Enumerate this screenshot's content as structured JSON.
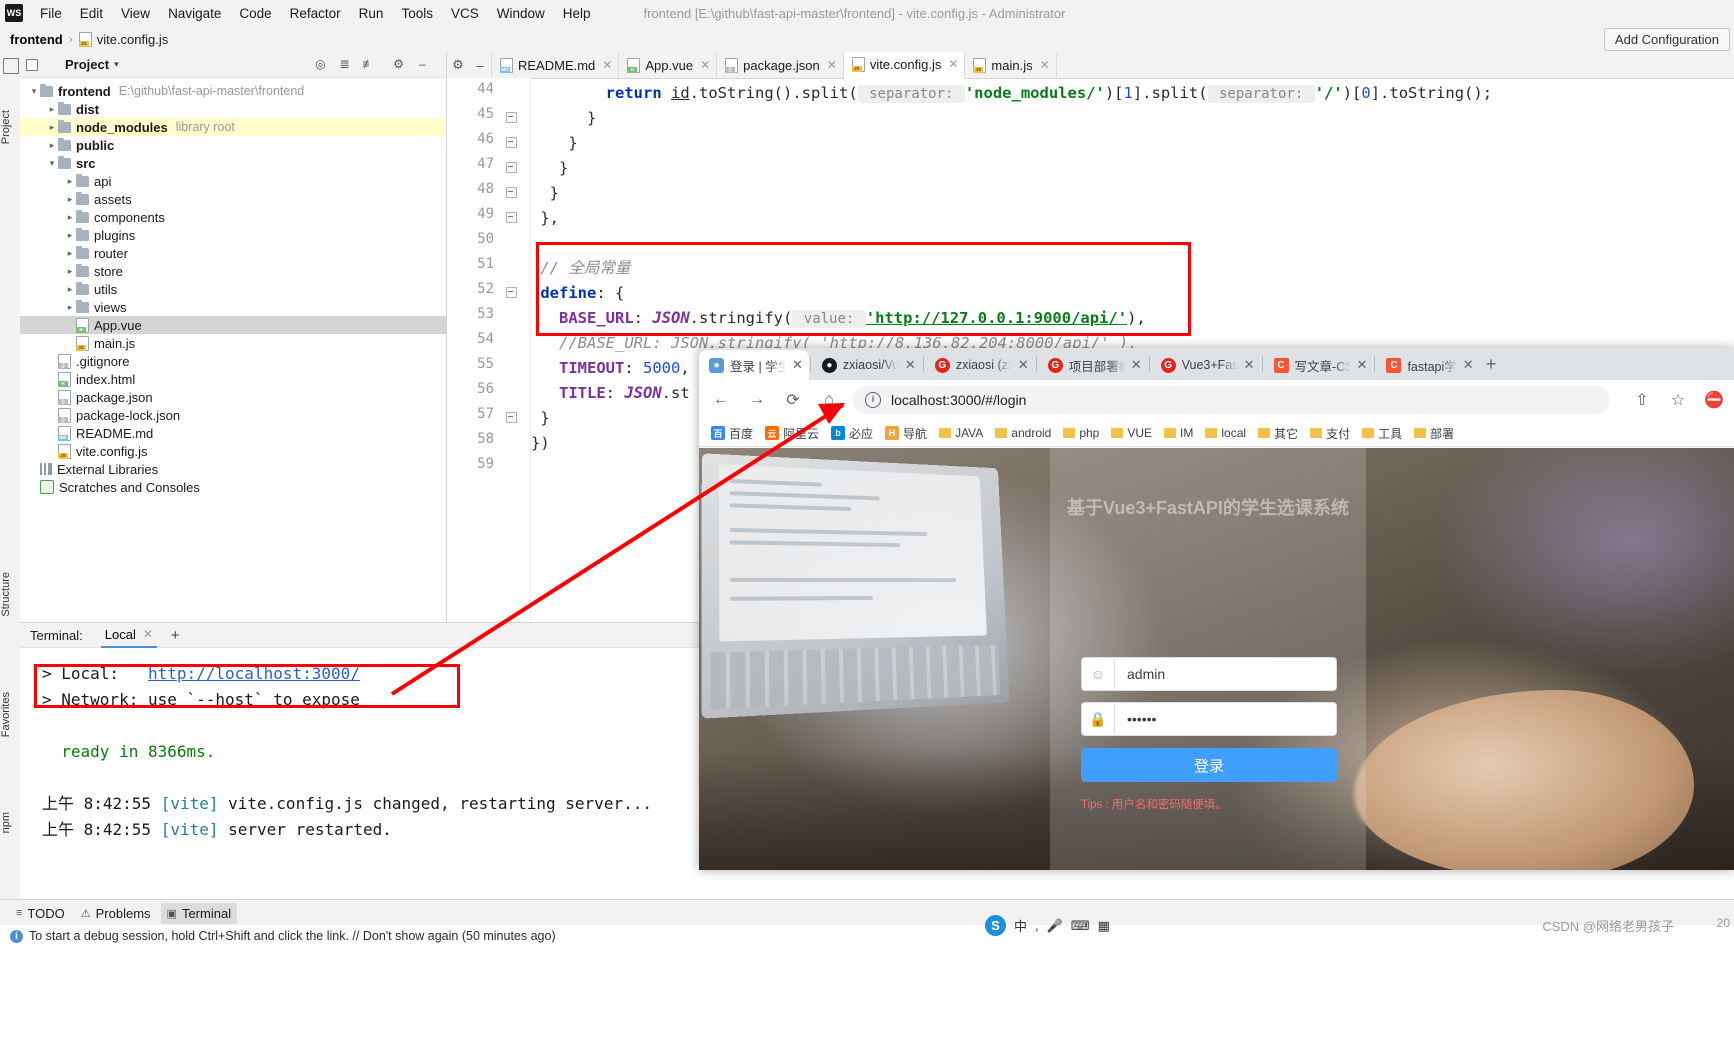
{
  "titlebar": {
    "logo": "WS",
    "menus": [
      "File",
      "Edit",
      "View",
      "Navigate",
      "Code",
      "Refactor",
      "Run",
      "Tools",
      "VCS",
      "Window",
      "Help"
    ],
    "title": "frontend [E:\\github\\fast-api-master\\frontend] - vite.config.js - Administrator"
  },
  "navbar": {
    "crumb_root": "frontend",
    "crumb_sep": "›",
    "crumb_file": "vite.config.js",
    "add_configuration": "Add Configuration"
  },
  "left_strip": {
    "project": "Project",
    "structure": "Structure",
    "favorites": "Favorites",
    "npm": "npm"
  },
  "project_panel": {
    "header": "Project",
    "header_caret": "▾",
    "tree": [
      {
        "depth": 0,
        "arrow": "open",
        "icon": "folder",
        "label": "frontend",
        "bold": true,
        "hint": "E:\\github\\fast-api-master\\frontend"
      },
      {
        "depth": 1,
        "arrow": "closed",
        "icon": "folder",
        "label": "dist",
        "bold": true,
        "hint": ""
      },
      {
        "depth": 1,
        "arrow": "closed",
        "icon": "folder",
        "label": "node_modules",
        "bold": true,
        "hint": "library root",
        "row": "lib"
      },
      {
        "depth": 1,
        "arrow": "closed",
        "icon": "folder",
        "label": "public",
        "bold": true,
        "hint": ""
      },
      {
        "depth": 1,
        "arrow": "open",
        "icon": "folder",
        "label": "src",
        "bold": true,
        "hint": ""
      },
      {
        "depth": 2,
        "arrow": "closed",
        "icon": "folder",
        "label": "api",
        "bold": false,
        "hint": ""
      },
      {
        "depth": 2,
        "arrow": "closed",
        "icon": "folder",
        "label": "assets",
        "bold": false,
        "hint": ""
      },
      {
        "depth": 2,
        "arrow": "closed",
        "icon": "folder",
        "label": "components",
        "bold": false,
        "hint": ""
      },
      {
        "depth": 2,
        "arrow": "closed",
        "icon": "folder",
        "label": "plugins",
        "bold": false,
        "hint": ""
      },
      {
        "depth": 2,
        "arrow": "closed",
        "icon": "folder",
        "label": "router",
        "bold": false,
        "hint": ""
      },
      {
        "depth": 2,
        "arrow": "closed",
        "icon": "folder",
        "label": "store",
        "bold": false,
        "hint": ""
      },
      {
        "depth": 2,
        "arrow": "closed",
        "icon": "folder",
        "label": "utils",
        "bold": false,
        "hint": ""
      },
      {
        "depth": 2,
        "arrow": "closed",
        "icon": "folder",
        "label": "views",
        "bold": false,
        "hint": ""
      },
      {
        "depth": 2,
        "arrow": "none",
        "icon": "file-h",
        "label": "App.vue",
        "bold": false,
        "hint": "",
        "row": "sel"
      },
      {
        "depth": 2,
        "arrow": "none",
        "icon": "file-js",
        "label": "main.js",
        "bold": false,
        "hint": ""
      },
      {
        "depth": 1,
        "arrow": "none",
        "icon": "file-json",
        "label": ".gitignore",
        "bold": false,
        "hint": ""
      },
      {
        "depth": 1,
        "arrow": "none",
        "icon": "file-h",
        "label": "index.html",
        "bold": false,
        "hint": ""
      },
      {
        "depth": 1,
        "arrow": "none",
        "icon": "file-json",
        "label": "package.json",
        "bold": false,
        "hint": ""
      },
      {
        "depth": 1,
        "arrow": "none",
        "icon": "file-json",
        "label": "package-lock.json",
        "bold": false,
        "hint": ""
      },
      {
        "depth": 1,
        "arrow": "none",
        "icon": "file-md",
        "label": "README.md",
        "bold": false,
        "hint": ""
      },
      {
        "depth": 1,
        "arrow": "none",
        "icon": "file-js",
        "label": "vite.config.js",
        "bold": false,
        "hint": ""
      },
      {
        "depth": 0,
        "arrow": "none",
        "icon": "lib",
        "label": "External Libraries",
        "bold": false,
        "hint": ""
      },
      {
        "depth": 0,
        "arrow": "none",
        "icon": "scratch",
        "label": "Scratches and Consoles",
        "bold": false,
        "hint": ""
      }
    ]
  },
  "editor": {
    "tabs": [
      {
        "label": "README.md",
        "badge": "md",
        "active": false
      },
      {
        "label": "App.vue",
        "badge": "h",
        "active": false
      },
      {
        "label": "package.json",
        "badge": "json",
        "active": false
      },
      {
        "label": "vite.config.js",
        "badge": "js",
        "active": true
      },
      {
        "label": "main.js",
        "badge": "js",
        "active": false
      }
    ],
    "line_numbers": [
      "44",
      "45",
      "46",
      "47",
      "48",
      "49",
      "50",
      "51",
      "52",
      "53",
      "54",
      "55",
      "56",
      "57",
      "58",
      "59"
    ],
    "lines": [
      {
        "n": "44",
        "tokens": [
          {
            "t": "        ",
            "c": "pun"
          },
          {
            "t": "return",
            "c": "kw"
          },
          {
            "t": " ",
            "c": "pun"
          },
          {
            "t": "id",
            "c": "idu"
          },
          {
            "t": ".",
            "c": "pun"
          },
          {
            "t": "toString",
            "c": "id"
          },
          {
            "t": "().",
            "c": "pun"
          },
          {
            "t": "split",
            "c": "id"
          },
          {
            "t": "(",
            "c": "pun"
          },
          {
            "t": " separator: ",
            "c": "hint"
          },
          {
            "t": "'node_modules/'",
            "c": "str"
          },
          {
            "t": ")[",
            "c": "pun"
          },
          {
            "t": "1",
            "c": "num"
          },
          {
            "t": "].",
            "c": "pun"
          },
          {
            "t": "split",
            "c": "id"
          },
          {
            "t": "(",
            "c": "pun"
          },
          {
            "t": " separator: ",
            "c": "hint"
          },
          {
            "t": "'/'",
            "c": "str"
          },
          {
            "t": ")[",
            "c": "pun"
          },
          {
            "t": "0",
            "c": "num"
          },
          {
            "t": "].",
            "c": "pun"
          },
          {
            "t": "toString",
            "c": "id"
          },
          {
            "t": "();",
            "c": "pun"
          }
        ]
      },
      {
        "n": "45",
        "tokens": [
          {
            "t": "      }",
            "c": "pun"
          }
        ]
      },
      {
        "n": "46",
        "tokens": [
          {
            "t": "    }",
            "c": "pun"
          }
        ]
      },
      {
        "n": "47",
        "tokens": [
          {
            "t": "   }",
            "c": "pun"
          }
        ]
      },
      {
        "n": "48",
        "tokens": [
          {
            "t": "  }",
            "c": "pun"
          }
        ]
      },
      {
        "n": "49",
        "tokens": [
          {
            "t": " },",
            "c": "pun"
          }
        ]
      },
      {
        "n": "50",
        "tokens": []
      },
      {
        "n": "51",
        "tokens": [
          {
            "t": " // 全局常量",
            "c": "cmt"
          }
        ]
      },
      {
        "n": "52",
        "tokens": [
          {
            "t": " define",
            "c": "kw"
          },
          {
            "t": ": {",
            "c": "pun"
          }
        ]
      },
      {
        "n": "53",
        "tokens": [
          {
            "t": "   BASE_URL",
            "c": "kw2"
          },
          {
            "t": ": ",
            "c": "pun"
          },
          {
            "t": "JSON",
            "c": "cls"
          },
          {
            "t": ".",
            "c": "pun"
          },
          {
            "t": "stringify",
            "c": "id"
          },
          {
            "t": "(",
            "c": "pun"
          },
          {
            "t": " value: ",
            "c": "hint"
          },
          {
            "t": "'http://127.0.0.1:9000/api/'",
            "c": "strlink"
          },
          {
            "t": "),",
            "c": "pun"
          }
        ]
      },
      {
        "n": "54",
        "tokens": [
          {
            "t": "   //BASE_URL: JSON.stringify(",
            "c": "cmt"
          },
          {
            "t": " 'http://8.136.82.204:8000/api/'",
            "c": "cmtlink"
          },
          {
            "t": " ),",
            "c": "cmt"
          }
        ]
      },
      {
        "n": "55",
        "tokens": [
          {
            "t": "   TIMEOUT",
            "c": "kw2"
          },
          {
            "t": ": ",
            "c": "pun"
          },
          {
            "t": "5000",
            "c": "num"
          },
          {
            "t": ",",
            "c": "pun"
          }
        ]
      },
      {
        "n": "56",
        "tokens": [
          {
            "t": "   TITLE",
            "c": "kw2"
          },
          {
            "t": ": ",
            "c": "pun"
          },
          {
            "t": "JSON",
            "c": "cls"
          },
          {
            "t": ".",
            "c": "pun"
          },
          {
            "t": "st",
            "c": "id"
          }
        ]
      },
      {
        "n": "57",
        "tokens": [
          {
            "t": " }",
            "c": "pun"
          }
        ]
      },
      {
        "n": "58",
        "tokens": [
          {
            "t": "})",
            "c": "pun"
          }
        ]
      },
      {
        "n": "59",
        "tokens": []
      }
    ]
  },
  "terminal": {
    "label": "Terminal:",
    "tab": "Local",
    "tab_close": "✕",
    "plus": "+",
    "lines": [
      [
        {
          "t": "> Local:   ",
          "c": "plain"
        },
        {
          "t": "http://localhost:3000/",
          "c": "link"
        }
      ],
      [
        {
          "t": "> Network: use `--host` to expose",
          "c": "plain"
        }
      ],
      [],
      [
        {
          "t": "  ready in 8366ms.",
          "c": "green"
        }
      ],
      [],
      [
        {
          "t": "上午 8:42:55 ",
          "c": "plain"
        },
        {
          "t": "[vite]",
          "c": "cyan"
        },
        {
          "t": " vite.config.js changed, restarting server...",
          "c": "plain"
        }
      ],
      [
        {
          "t": "上午 8:42:55 ",
          "c": "plain"
        },
        {
          "t": "[vite]",
          "c": "cyan"
        },
        {
          "t": " server restarted.",
          "c": "plain"
        }
      ]
    ]
  },
  "statusbar": {
    "items": [
      {
        "label": "TODO",
        "icon": "list-icon",
        "active": false
      },
      {
        "label": "Problems",
        "icon": "warning-icon",
        "active": false
      },
      {
        "label": "Terminal",
        "icon": "terminal-icon",
        "active": true
      }
    ]
  },
  "hintbar": {
    "icon": "info-icon",
    "text": "To start a debug session, hold Ctrl+Shift and click the link. // Don't show again (50 minutes ago)"
  },
  "browser": {
    "tabs": [
      {
        "label": "登录 | 学生",
        "favicon": "student-icon",
        "fav_class": "fav-blue",
        "fav_text": "●",
        "active": true
      },
      {
        "label": "zxiaosi/Vu",
        "favicon": "github-icon",
        "fav_class": "fav-gh",
        "fav_text": "",
        "active": false
      },
      {
        "label": "zxiaosi (zx",
        "favicon": "gitee-icon",
        "fav_class": "fav-g",
        "fav_text": "G",
        "active": false
      },
      {
        "label": "项目部署教",
        "favicon": "gitee-icon",
        "fav_class": "fav-g",
        "fav_text": "G",
        "active": false
      },
      {
        "label": "Vue3+Fas",
        "favicon": "gitee-icon",
        "fav_class": "fav-g",
        "fav_text": "G",
        "active": false
      },
      {
        "label": "写文章-CS",
        "favicon": "csdn-icon",
        "fav_class": "fav-c",
        "fav_text": "C",
        "active": false
      },
      {
        "label": "fastapi学",
        "favicon": "csdn-icon",
        "fav_class": "fav-c",
        "fav_text": "C",
        "active": false
      }
    ],
    "tab_close": "✕",
    "new_tab": "+",
    "toolbar": {
      "back": "←",
      "forward": "→",
      "reload": "⟳",
      "home": "⌂",
      "url": "localhost:3000/#/login",
      "info": "i",
      "share": "⇧",
      "star": "☆",
      "extension": "⛔"
    },
    "bookmarks": [
      {
        "label": "百度",
        "type": "site",
        "color": "#3388ff",
        "glyph": "百"
      },
      {
        "label": "阿里云",
        "type": "site",
        "color": "#ff6a00",
        "glyph": "云"
      },
      {
        "label": "必应",
        "type": "site",
        "color": "#008ad7",
        "glyph": "b"
      },
      {
        "label": "导航",
        "type": "site",
        "color": "#f2a33c",
        "glyph": "H"
      },
      {
        "label": "JAVA",
        "type": "folder"
      },
      {
        "label": "android",
        "type": "folder"
      },
      {
        "label": "php",
        "type": "folder"
      },
      {
        "label": "VUE",
        "type": "folder"
      },
      {
        "label": "IM",
        "type": "folder"
      },
      {
        "label": "local",
        "type": "folder"
      },
      {
        "label": "其它",
        "type": "folder"
      },
      {
        "label": "支付",
        "type": "folder"
      },
      {
        "label": "工具",
        "type": "folder"
      },
      {
        "label": "部署",
        "type": "folder"
      }
    ],
    "login_page": {
      "title": "基于Vue3+FastAPI的学生选课系统",
      "username_value": "admin",
      "username_icon": "user-icon",
      "password_value": "••••••",
      "password_icon": "lock-icon",
      "submit_label": "登录",
      "tips": "Tips : 用户名和密码随便填。"
    }
  },
  "ime": {
    "logo": "S",
    "lang": "中",
    "comma": ",",
    "mic_icon": "mic-icon",
    "keyboard_icon": "keyboard-icon",
    "apps_icon": "apps-icon"
  },
  "watermark": {
    "text": "CSDN @网络老男孩子",
    "right": "20"
  },
  "colors": {
    "accent_red": "#ff0000",
    "link_blue": "#2b5ed1",
    "button_blue": "#409eff",
    "string_green": "#067d17",
    "keyword_blue": "#0033b3"
  }
}
